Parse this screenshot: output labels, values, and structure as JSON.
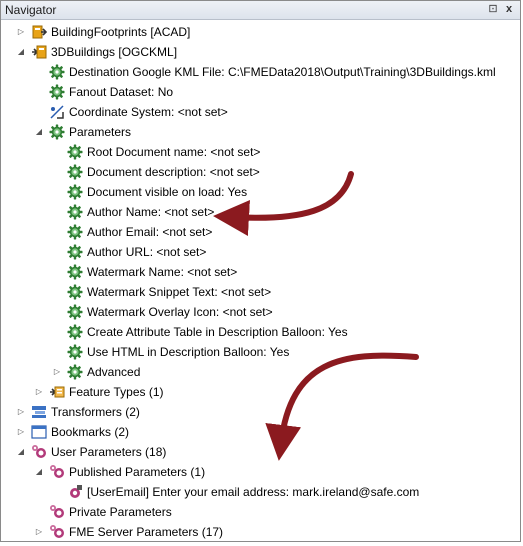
{
  "window": {
    "title": "Navigator",
    "pin_glyph": "⊡",
    "close_glyph": "x"
  },
  "tree": [
    {
      "label": "BuildingFootprints [ACAD]",
      "icon": "reader-icon",
      "level": 0,
      "toggle": "collapsed"
    },
    {
      "label": "3DBuildings [OGCKML]",
      "icon": "writer-icon",
      "level": 0,
      "toggle": "expanded"
    },
    {
      "label": "Destination Google KML File: C:\\FMEData2018\\Output\\Training\\3DBuildings.kml",
      "icon": "gear-icon",
      "level": 1,
      "toggle": "none"
    },
    {
      "label": "Fanout Dataset: No",
      "icon": "gear-icon",
      "level": 1,
      "toggle": "none"
    },
    {
      "label": "Coordinate System: <not set>",
      "icon": "coordinate-system-icon",
      "level": 1,
      "toggle": "none"
    },
    {
      "label": "Parameters",
      "icon": "gear-icon",
      "level": 1,
      "toggle": "expanded"
    },
    {
      "label": "Root Document name: <not set>",
      "icon": "gear-icon",
      "level": 2,
      "toggle": "none"
    },
    {
      "label": "Document description: <not set>",
      "icon": "gear-icon",
      "level": 2,
      "toggle": "none"
    },
    {
      "label": "Document visible on load: Yes",
      "icon": "gear-icon",
      "level": 2,
      "toggle": "none"
    },
    {
      "label": "Author Name: <not set>",
      "icon": "gear-icon",
      "level": 2,
      "toggle": "none"
    },
    {
      "label": "Author Email: <not set>",
      "icon": "gear-icon",
      "level": 2,
      "toggle": "none"
    },
    {
      "label": "Author URL: <not set>",
      "icon": "gear-icon",
      "level": 2,
      "toggle": "none"
    },
    {
      "label": "Watermark Name: <not set>",
      "icon": "gear-icon",
      "level": 2,
      "toggle": "none"
    },
    {
      "label": "Watermark Snippet Text: <not set>",
      "icon": "gear-icon",
      "level": 2,
      "toggle": "none"
    },
    {
      "label": "Watermark Overlay Icon: <not set>",
      "icon": "gear-icon",
      "level": 2,
      "toggle": "none"
    },
    {
      "label": "Create Attribute Table in Description Balloon: Yes",
      "icon": "gear-icon",
      "level": 2,
      "toggle": "none"
    },
    {
      "label": "Use HTML in Description Balloon: Yes",
      "icon": "gear-icon",
      "level": 2,
      "toggle": "none"
    },
    {
      "label": "Advanced",
      "icon": "gear-icon",
      "level": 2,
      "toggle": "collapsed"
    },
    {
      "label": "Feature Types (1)",
      "icon": "feature-types-icon",
      "level": 1,
      "toggle": "collapsed"
    },
    {
      "label": "Transformers (2)",
      "icon": "transformers-icon",
      "level": 0,
      "toggle": "collapsed"
    },
    {
      "label": "Bookmarks (2)",
      "icon": "bookmarks-icon",
      "level": 0,
      "toggle": "collapsed"
    },
    {
      "label": "User Parameters (18)",
      "icon": "user-parameters-icon",
      "level": 0,
      "toggle": "expanded"
    },
    {
      "label": "Published Parameters (1)",
      "icon": "user-parameters-icon",
      "level": 1,
      "toggle": "expanded"
    },
    {
      "label": "[UserEmail] Enter your email address: mark.ireland@safe.com",
      "icon": "user-parameter-icon",
      "level": 2,
      "toggle": "none"
    },
    {
      "label": "Private Parameters",
      "icon": "user-parameters-icon",
      "level": 1,
      "toggle": "none"
    },
    {
      "label": "FME Server Parameters (17)",
      "icon": "user-parameters-icon",
      "level": 1,
      "toggle": "collapsed"
    }
  ],
  "colors": {
    "gear": "#2e7d32",
    "gear_light": "#7cc47f",
    "arrow": "#8b1a1f",
    "reader": "#e8a317",
    "writer": "#e8a317"
  }
}
